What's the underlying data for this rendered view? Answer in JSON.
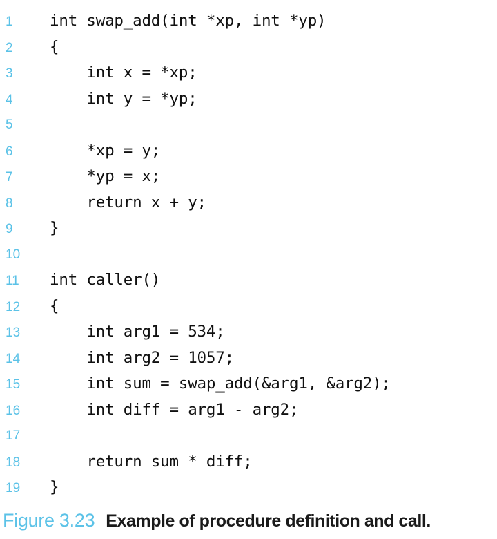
{
  "colors": {
    "line_number": "#5bc2e7",
    "caption_label": "#5bc2e7",
    "caption_text": "#1a1a1a",
    "code_text": "#101010",
    "background": "#ffffff"
  },
  "caption": {
    "label": "Figure 3.23",
    "text": "Example of procedure definition and call."
  },
  "code": {
    "language": "c",
    "lines": [
      {
        "number": "1",
        "text": "int swap_add(int *xp, int *yp)"
      },
      {
        "number": "2",
        "text": "{"
      },
      {
        "number": "3",
        "text": "    int x = *xp;"
      },
      {
        "number": "4",
        "text": "    int y = *yp;"
      },
      {
        "number": "5",
        "text": ""
      },
      {
        "number": "6",
        "text": "    *xp = y;"
      },
      {
        "number": "7",
        "text": "    *yp = x;"
      },
      {
        "number": "8",
        "text": "    return x + y;"
      },
      {
        "number": "9",
        "text": "}"
      },
      {
        "number": "10",
        "text": ""
      },
      {
        "number": "11",
        "text": "int caller()"
      },
      {
        "number": "12",
        "text": "{"
      },
      {
        "number": "13",
        "text": "    int arg1 = 534;"
      },
      {
        "number": "14",
        "text": "    int arg2 = 1057;"
      },
      {
        "number": "15",
        "text": "    int sum = swap_add(&arg1, &arg2);"
      },
      {
        "number": "16",
        "text": "    int diff = arg1 - arg2;"
      },
      {
        "number": "17",
        "text": ""
      },
      {
        "number": "18",
        "text": "    return sum * diff;"
      },
      {
        "number": "19",
        "text": "}"
      }
    ]
  }
}
